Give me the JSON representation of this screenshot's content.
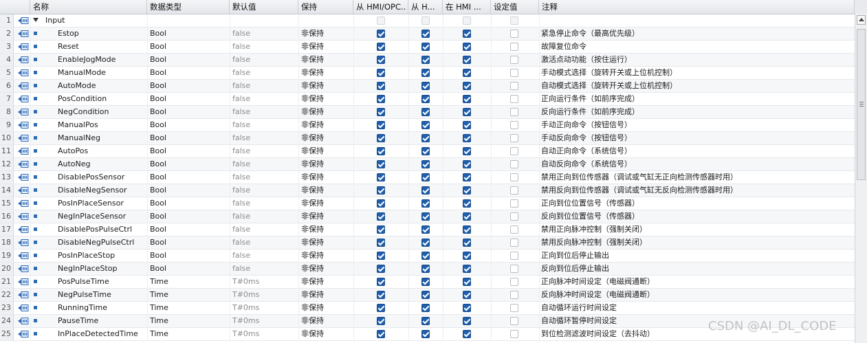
{
  "columns": {
    "name": "名称",
    "datatype": "数据类型",
    "default": "默认值",
    "retain": "保持",
    "hmi_opc": "从 HMI/OPC..",
    "from_h": "从 H...",
    "in_hmi": "在 HMI ...",
    "setpoint": "设定值",
    "comment": "注释"
  },
  "section": {
    "index": "1",
    "name": "Input"
  },
  "rows": [
    {
      "index": "2",
      "name": "Estop",
      "datatype": "Bool",
      "default": "false",
      "retain": "非保持",
      "comment": "紧急停止命令（最高优先级）"
    },
    {
      "index": "3",
      "name": "Reset",
      "datatype": "Bool",
      "default": "false",
      "retain": "非保持",
      "comment": "故障复位命令"
    },
    {
      "index": "4",
      "name": "EnableJogMode",
      "datatype": "Bool",
      "default": "false",
      "retain": "非保持",
      "comment": "激活点动功能（按住运行）"
    },
    {
      "index": "5",
      "name": "ManualMode",
      "datatype": "Bool",
      "default": "false",
      "retain": "非保持",
      "comment": "手动模式选择（旋转开关或上位机控制）"
    },
    {
      "index": "6",
      "name": "AutoMode",
      "datatype": "Bool",
      "default": "false",
      "retain": "非保持",
      "comment": "自动模式选择（旋转开关或上位机控制）"
    },
    {
      "index": "7",
      "name": "PosCondition",
      "datatype": "Bool",
      "default": "false",
      "retain": "非保持",
      "comment": "正向运行条件（如前序完成）"
    },
    {
      "index": "8",
      "name": "NegCondition",
      "datatype": "Bool",
      "default": "false",
      "retain": "非保持",
      "comment": "反向运行条件（如前序完成）"
    },
    {
      "index": "9",
      "name": "ManualPos",
      "datatype": "Bool",
      "default": "false",
      "retain": "非保持",
      "comment": "手动正向命令（按钮信号）"
    },
    {
      "index": "10",
      "name": "ManualNeg",
      "datatype": "Bool",
      "default": "false",
      "retain": "非保持",
      "comment": "手动反向命令（按钮信号）"
    },
    {
      "index": "11",
      "name": "AutoPos",
      "datatype": "Bool",
      "default": "false",
      "retain": "非保持",
      "comment": "自动正向命令（系统信号）"
    },
    {
      "index": "12",
      "name": "AutoNeg",
      "datatype": "Bool",
      "default": "false",
      "retain": "非保持",
      "comment": "自动反向命令（系统信号）"
    },
    {
      "index": "13",
      "name": "DisablePosSensor",
      "datatype": "Bool",
      "default": "false",
      "retain": "非保持",
      "comment": "禁用正向到位传感器（调试或气缸无正向检测传感器时用）"
    },
    {
      "index": "14",
      "name": "DisableNegSensor",
      "datatype": "Bool",
      "default": "false",
      "retain": "非保持",
      "comment": "禁用反向到位传感器（调试或气缸无反向检测传感器时用）"
    },
    {
      "index": "15",
      "name": "PosInPlaceSensor",
      "datatype": "Bool",
      "default": "false",
      "retain": "非保持",
      "comment": "正向到位位置信号（传感器）"
    },
    {
      "index": "16",
      "name": "NegInPlaceSensor",
      "datatype": "Bool",
      "default": "false",
      "retain": "非保持",
      "comment": "反向到位位置信号（传感器）"
    },
    {
      "index": "17",
      "name": "DisablePosPulseCtrl",
      "datatype": "Bool",
      "default": "false",
      "retain": "非保持",
      "comment": "禁用正向脉冲控制（强制关闭）"
    },
    {
      "index": "18",
      "name": "DisableNegPulseCtrl",
      "datatype": "Bool",
      "default": "false",
      "retain": "非保持",
      "comment": "禁用反向脉冲控制（强制关闭）"
    },
    {
      "index": "19",
      "name": "PosInPlaceStop",
      "datatype": "Bool",
      "default": "false",
      "retain": "非保持",
      "comment": "正向到位后停止输出"
    },
    {
      "index": "20",
      "name": "NegInPlaceStop",
      "datatype": "Bool",
      "default": "false",
      "retain": "非保持",
      "comment": "反向到位后停止输出"
    },
    {
      "index": "21",
      "name": "PosPulseTime",
      "datatype": "Time",
      "default": "T#0ms",
      "retain": "非保持",
      "comment": "正向脉冲时间设定（电磁阀通断）"
    },
    {
      "index": "22",
      "name": "NegPulseTime",
      "datatype": "Time",
      "default": "T#0ms",
      "retain": "非保持",
      "comment": "反向脉冲时间设定（电磁阀通断）"
    },
    {
      "index": "23",
      "name": "RunningTime",
      "datatype": "Time",
      "default": "T#0ms",
      "retain": "非保持",
      "comment": "自动循环运行时间设定"
    },
    {
      "index": "24",
      "name": "PauseTime",
      "datatype": "Time",
      "default": "T#0ms",
      "retain": "非保持",
      "comment": "自动循环暂停时间设定"
    },
    {
      "index": "25",
      "name": "InPlaceDetectedTime",
      "datatype": "Time",
      "default": "T#0ms",
      "retain": "非保持",
      "comment": "到位检测滤波时间设定（去抖动）"
    }
  ],
  "checkbox_state": {
    "hmi_opc": true,
    "from_h": true,
    "in_hmi": true,
    "setpoint": false
  },
  "colors": {
    "checked": "#1f5fae",
    "icon": "#2f6bb5"
  },
  "watermark": "CSDN @AI_DL_CODE"
}
